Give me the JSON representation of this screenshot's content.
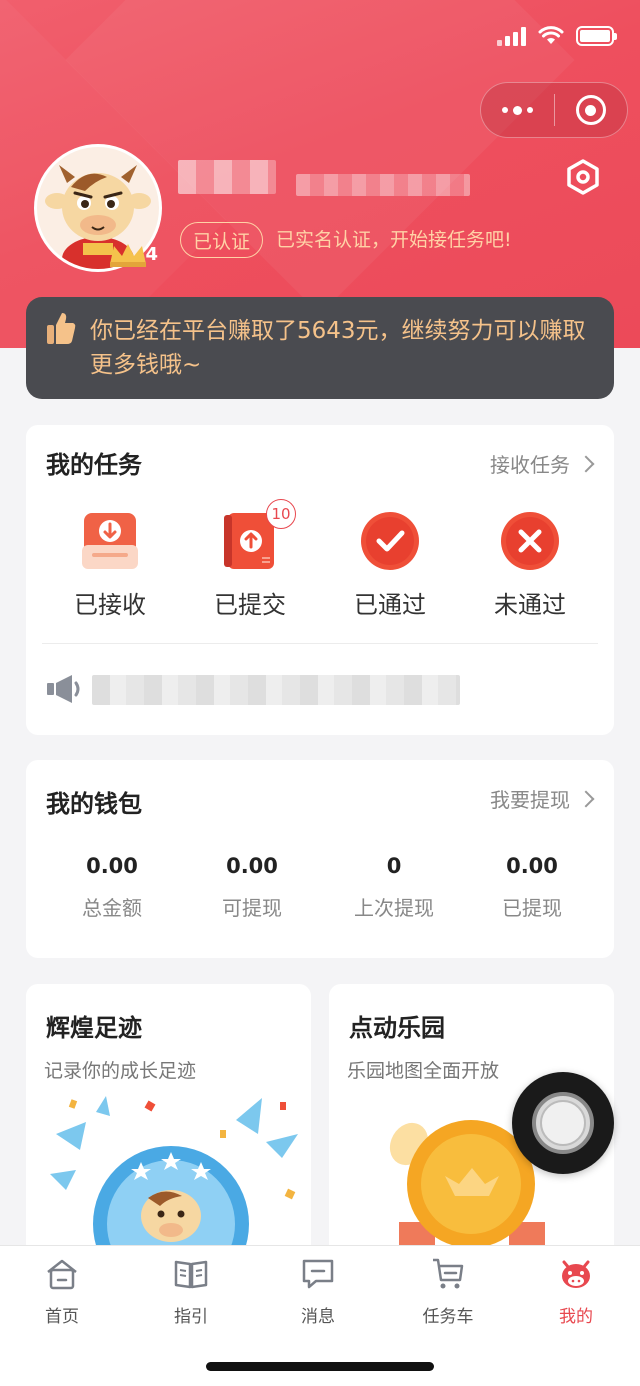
{
  "status_bar": {
    "signal": "signal-icon",
    "wifi": "wifi-icon",
    "battery": "battery-icon"
  },
  "capsule": {
    "more": "more-icon",
    "close": "target-icon"
  },
  "profile": {
    "avatar": "cow-avatar",
    "level": "4",
    "verified_badge": "已认证",
    "verified_text": "已实名认证，开始接任务吧!"
  },
  "banner": {
    "icon": "thumbs-up-icon",
    "text": "你已经在平台赚取了5643元，继续努力可以赚取更多钱哦~",
    "earned_amount": 5643
  },
  "tasks": {
    "title": "我的任务",
    "link": "接收任务",
    "items": [
      {
        "label": "已接收",
        "icon": "inbox-download-icon",
        "badge": ""
      },
      {
        "label": "已提交",
        "icon": "upload-doc-icon",
        "badge": "10"
      },
      {
        "label": "已通过",
        "icon": "check-circle-icon",
        "badge": ""
      },
      {
        "label": "未通过",
        "icon": "x-circle-icon",
        "badge": ""
      }
    ]
  },
  "wallet": {
    "title": "我的钱包",
    "link": "我要提现",
    "items": [
      {
        "amount": "0.00",
        "label": "总金额"
      },
      {
        "amount": "0.00",
        "label": "可提现"
      },
      {
        "amount": "0",
        "label": "上次提现"
      },
      {
        "amount": "0.00",
        "label": "已提现"
      }
    ]
  },
  "promos": [
    {
      "title": "辉煌足迹",
      "subtitle": "记录你的成长足迹"
    },
    {
      "title": "点动乐园",
      "subtitle": "乐园地图全面开放"
    }
  ],
  "tabbar": [
    {
      "label": "首页",
      "icon": "home-icon"
    },
    {
      "label": "指引",
      "icon": "book-icon"
    },
    {
      "label": "消息",
      "icon": "message-icon"
    },
    {
      "label": "任务车",
      "icon": "cart-icon"
    },
    {
      "label": "我的",
      "icon": "cow-icon",
      "active": true
    }
  ],
  "colors": {
    "brand_red": "#ec4a59",
    "accent_gold": "#f5c28a",
    "active_tab": "#e8484f"
  }
}
